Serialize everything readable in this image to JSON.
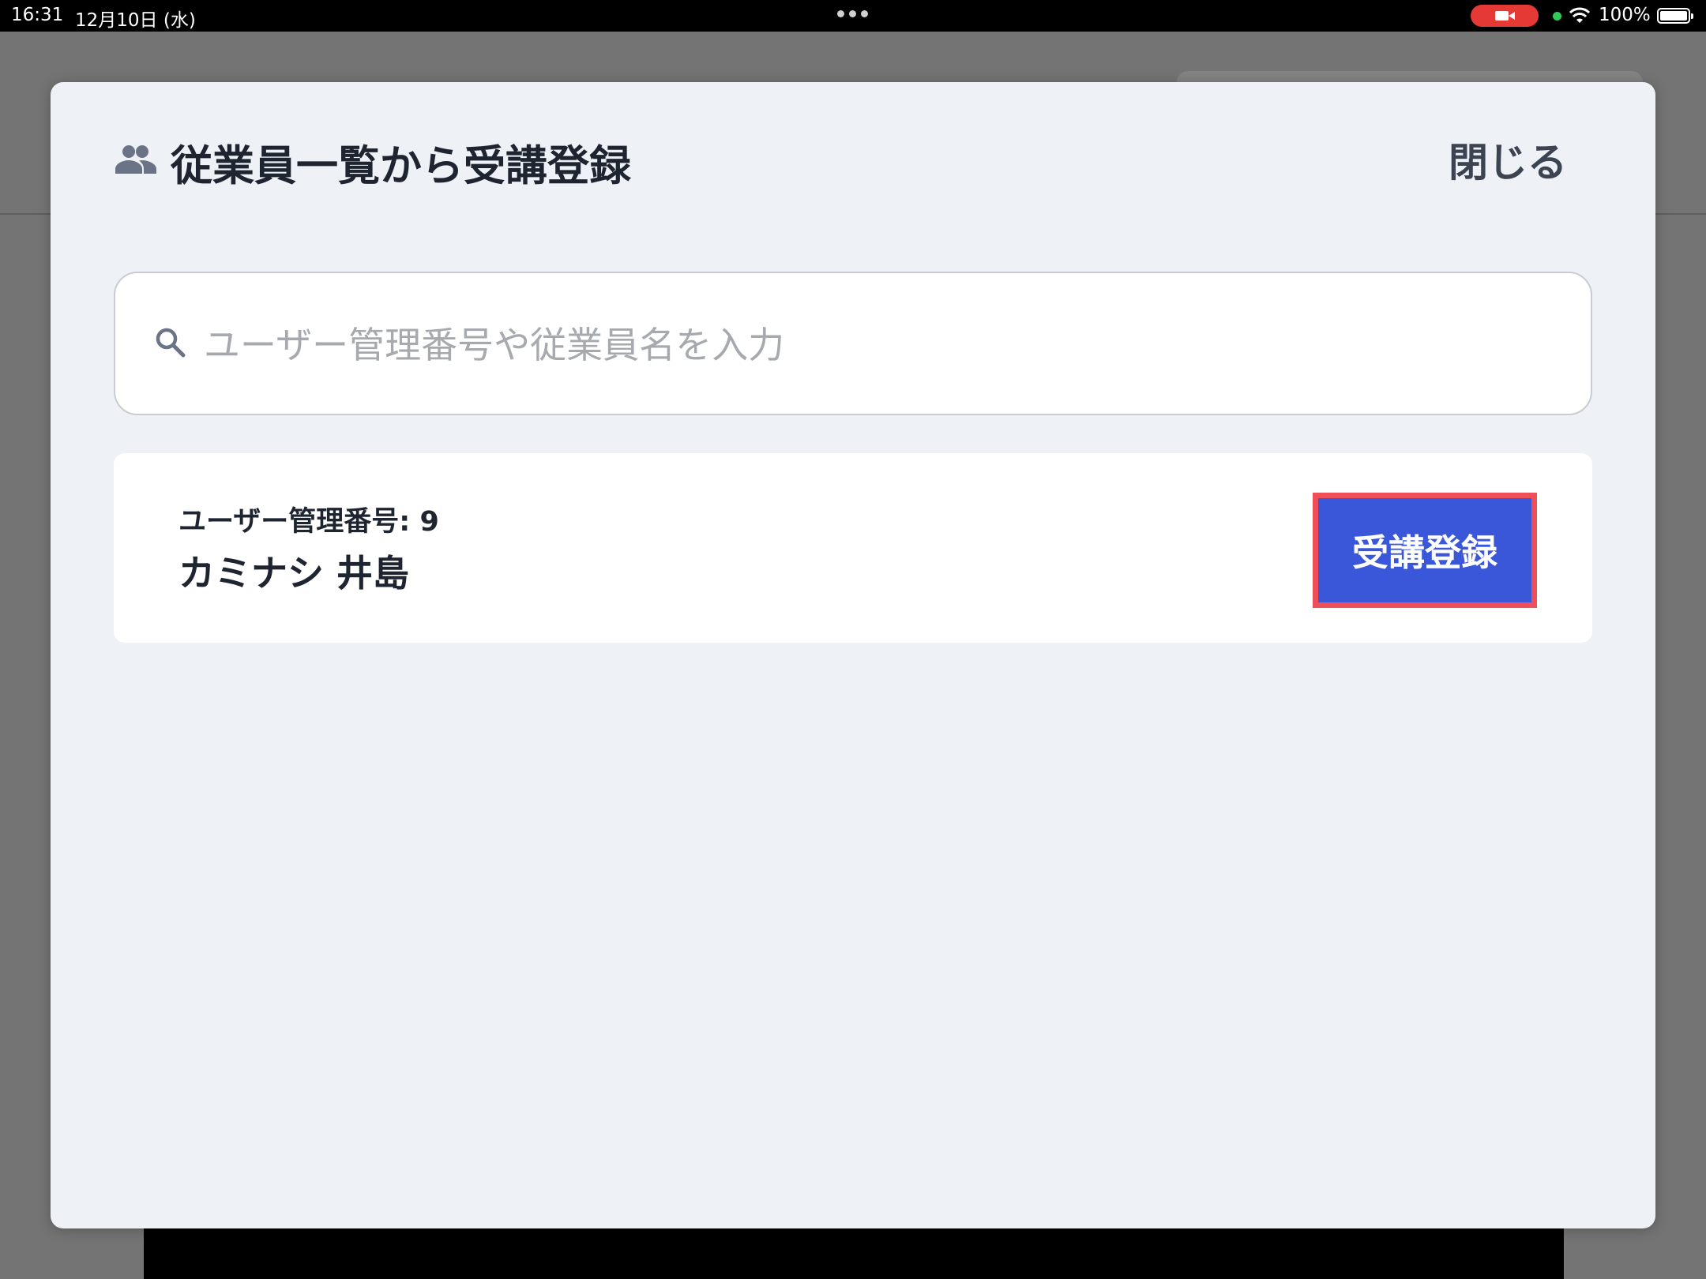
{
  "status_bar": {
    "time": "16:31",
    "date": "12月10日 (水)",
    "battery": "100%",
    "camera_indicator_color": "#e53935",
    "icons": [
      "more-dots-icon",
      "camera-indicator-icon",
      "privacy-dot-icon",
      "wifi-icon",
      "battery-icon"
    ]
  },
  "modal": {
    "title": "従業員一覧から受講登録",
    "title_icon": "people-icon",
    "close_label": "閉じる",
    "background": "#eef1f6"
  },
  "search": {
    "placeholder": "ユーザー管理番号や従業員名を入力",
    "value": "",
    "icon": "search-icon"
  },
  "results": [
    {
      "user_id_label": "ユーザー管理番号: 9",
      "name": "カミナシ 井島",
      "action_label": "受講登録"
    }
  ],
  "colors": {
    "primary_button": "#3b57d9",
    "highlight_border": "#ef4f58",
    "text_dark": "#1f2530"
  }
}
